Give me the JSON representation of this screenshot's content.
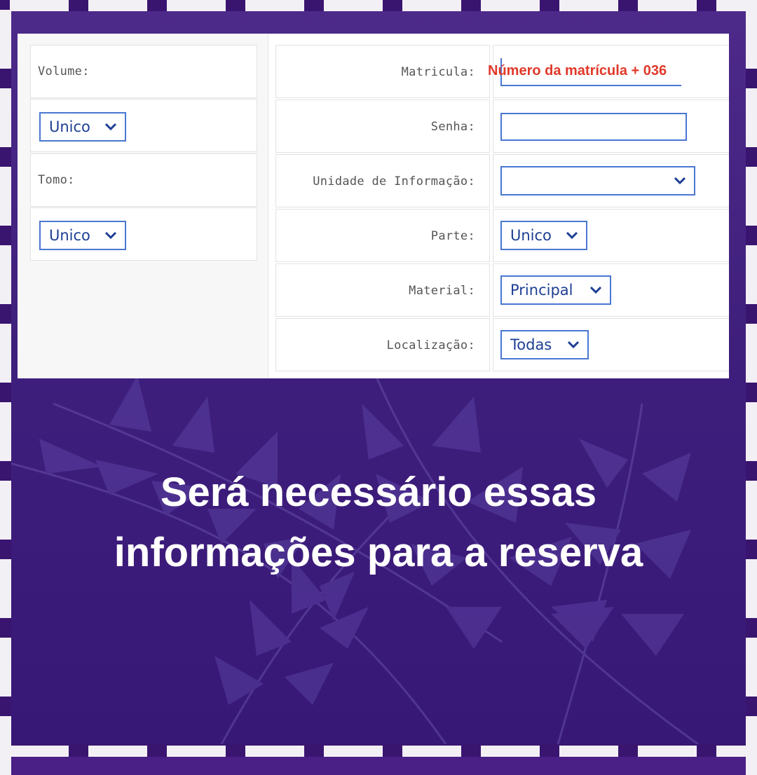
{
  "left_panel": {
    "volume_label": "Volume:",
    "volume_value": "Unico",
    "tomo_label": "Tomo:",
    "tomo_value": "Unico"
  },
  "form": {
    "matricula_label": "Matricula:",
    "senha_label": "Senha:",
    "unidade_label": "Unidade de Informação:",
    "unidade_value": "",
    "parte_label": "Parte:",
    "parte_value": "Unico",
    "material_label": "Material:",
    "material_value": "Principal",
    "localizacao_label": "Localização:",
    "localizacao_value": "Todas"
  },
  "annotation": {
    "matricula_hint": "Número da matrícula + 036"
  },
  "caption": {
    "line1": "Será necessário essas",
    "line2": "informações para a reserva"
  },
  "colors": {
    "background_purple": "#3f1f7c",
    "frame_tile": "#f3f0f5",
    "input_border": "#4a77d2",
    "annotation_red": "#e0392a"
  }
}
